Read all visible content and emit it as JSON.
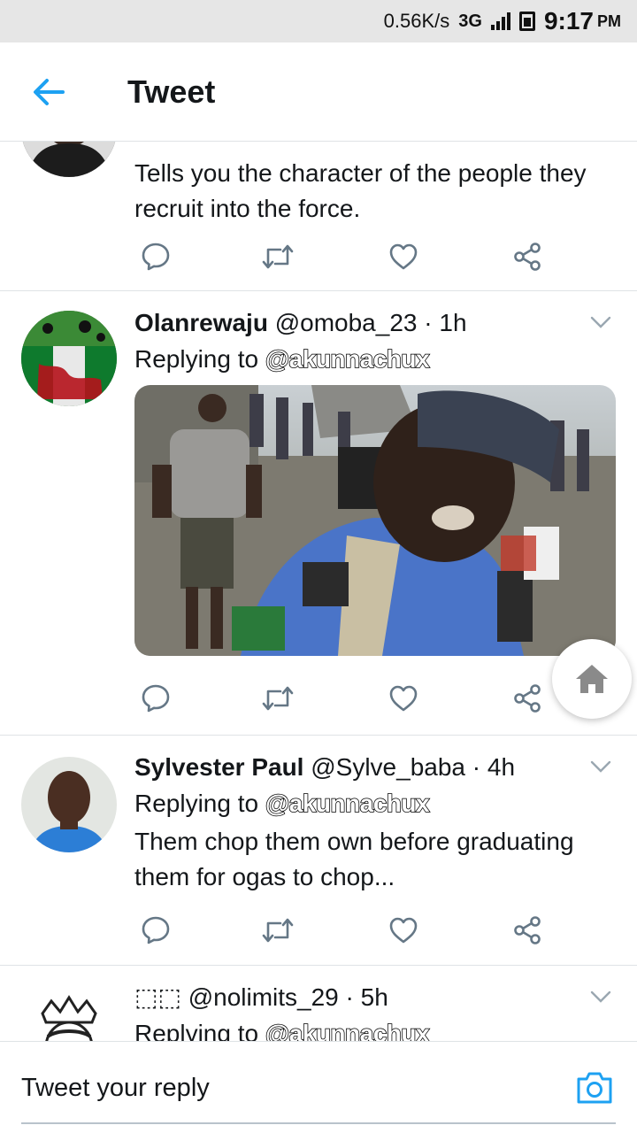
{
  "status_bar": {
    "net_speed": "0.56K/s",
    "network_type": "3G",
    "network_type_small": "3G",
    "time": "9:17",
    "ampm": "PM"
  },
  "app_bar": {
    "title": "Tweet",
    "back_icon": "arrow-left-icon"
  },
  "colors": {
    "accent": "#1da1f2",
    "text": "#14171a",
    "icon_gray": "#657786",
    "divider": "#dfe3e6"
  },
  "tweets": [
    {
      "text": "Tells you the character of the people they recruit into the force."
    },
    {
      "name": "Olanrewaju",
      "handle": "@omoba_23",
      "separator": "·",
      "time": "1h",
      "replying_prefix": "Replying to",
      "replying_to": "@akunnachux",
      "has_media": true
    },
    {
      "name": "Sylvester Paul",
      "handle": "@Sylve_baba",
      "separator": "·",
      "time": "4h",
      "replying_prefix": "Replying to",
      "replying_to": "@akunnachux",
      "text": "Them chop them own before graduating them for ogas to chop..."
    },
    {
      "name": "⬚⬚",
      "handle": "@nolimits_29",
      "separator": "·",
      "time": "5h",
      "replying_prefix": "Replying to",
      "replying_to": "@akunnachux"
    }
  ],
  "action_icons": [
    "reply-icon",
    "retweet-icon",
    "like-icon",
    "share-icon"
  ],
  "composer": {
    "placeholder": "Tweet your reply",
    "camera_icon": "camera-icon"
  },
  "fab": {
    "icon": "home-icon"
  }
}
